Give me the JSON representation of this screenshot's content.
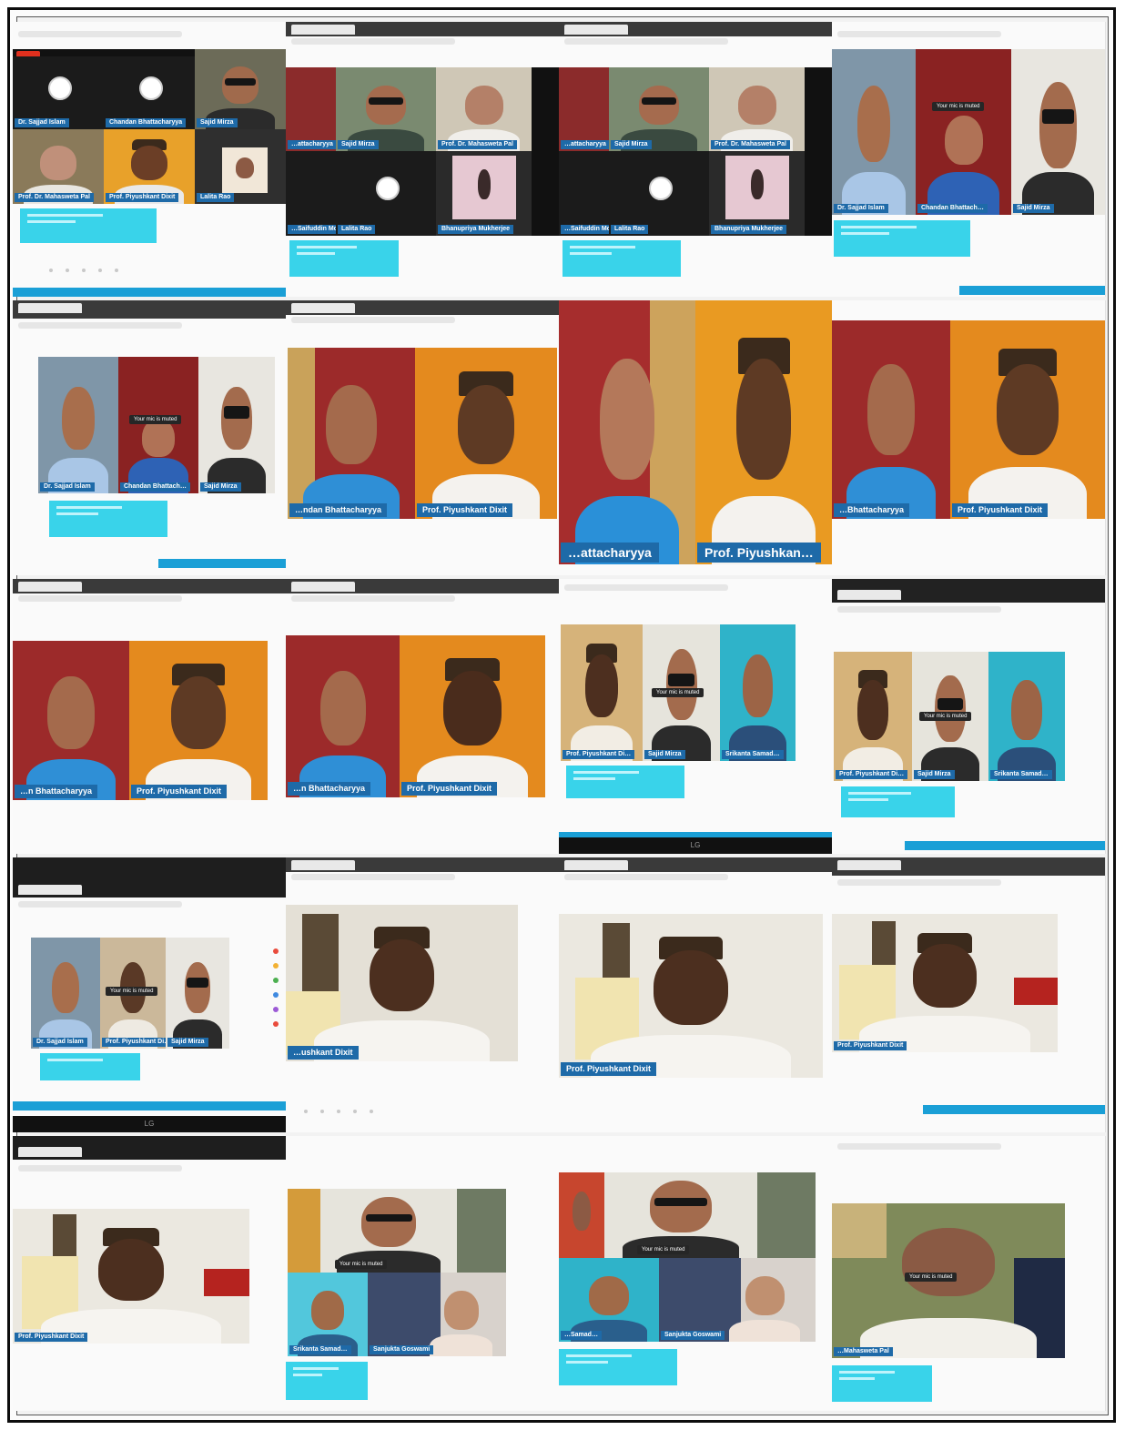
{
  "collage": {
    "frames": [
      {
        "id": "1-1",
        "names": [
          "Dr. Sajjad Islam",
          "Chandan Bhattacharyya",
          "Sajid Mirza",
          "Prof. Dr. Mahasweta Pal",
          "Prof. Piyushkant Dixit",
          "Lalita Rao"
        ]
      },
      {
        "id": "1-2",
        "names": [
          "…attacharyya",
          "Sajid Mirza",
          "Prof. Dr. Mahasweta Pal",
          "…Saifuddin Mollick",
          "Lalita Rao",
          "Bhanupriya Mukherjee"
        ]
      },
      {
        "id": "1-3",
        "names": [
          "…attacharyya",
          "Sajid Mirza",
          "Prof. Dr. Mahasweta Pal",
          "…Saifuddin Mollick",
          "Lalita Rao",
          "Bhanupriya Mukherjee"
        ]
      },
      {
        "id": "1-4",
        "names": [
          "Dr. Sajjad Islam",
          "Chandan Bhattach…",
          "Sajid Mirza"
        ],
        "mute_notice": "Your mic is muted"
      },
      {
        "id": "2-1",
        "names": [
          "Dr. Sajjad Islam",
          "Chandan Bhattach…",
          "Sajid Mirza"
        ],
        "mute_notice": "Your mic is muted"
      },
      {
        "id": "2-2",
        "names": [
          "…ndan Bhattacharyya",
          "Prof. Piyushkant Dixit"
        ]
      },
      {
        "id": "2-3",
        "names": [
          "…attacharyya",
          "Prof. Piyushkan…"
        ]
      },
      {
        "id": "2-4",
        "names": [
          "…Bhattacharyya",
          "Prof. Piyushkant Dixit"
        ]
      },
      {
        "id": "3-1",
        "names": [
          "…n Bhattacharyya",
          "Prof. Piyushkant Dixit"
        ]
      },
      {
        "id": "3-2",
        "names": [
          "…n Bhattacharyya",
          "Prof. Piyushkant Dixit"
        ]
      },
      {
        "id": "3-3",
        "names": [
          "Prof. Piyushkant Di…",
          "Sajid Mirza",
          "Srikanta Samad…"
        ],
        "mute_notice": "Your mic is muted"
      },
      {
        "id": "3-4",
        "names": [
          "Prof. Piyushkant Di…",
          "Sajid Mirza",
          "Srikanta Samad…"
        ],
        "mute_notice": "Your mic is muted"
      },
      {
        "id": "4-1",
        "names": [
          "Dr. Sajjad Islam",
          "Prof. Piyushkant Di…",
          "Sajid Mirza"
        ],
        "mute_notice": "Your mic is muted"
      },
      {
        "id": "4-2",
        "names": [
          "…ushkant Dixit"
        ]
      },
      {
        "id": "4-3",
        "names": [
          "Prof. Piyushkant Dixit"
        ]
      },
      {
        "id": "4-4",
        "names": [
          "Prof. Piyushkant Dixit"
        ]
      },
      {
        "id": "5-1",
        "names": [
          "Prof. Piyushkant Dixit"
        ]
      },
      {
        "id": "5-2",
        "names": [
          "Srikanta Samad…",
          "Sanjukta Goswami"
        ],
        "mute_notice": "Your mic is muted"
      },
      {
        "id": "5-3",
        "names": [
          "…Samad…",
          "Sanjukta Goswami"
        ],
        "mute_notice": "Your mic is muted"
      },
      {
        "id": "5-4",
        "names": [
          "…Mahasweta Pal"
        ],
        "mute_notice": "Your mic is muted"
      }
    ],
    "monitor_brand": "LG",
    "colors": {
      "accent_cyan": "#39d3ea",
      "name_tag": "#1e6aa8",
      "record": "#e0301e",
      "taskbar": "#1a9fd6"
    }
  }
}
